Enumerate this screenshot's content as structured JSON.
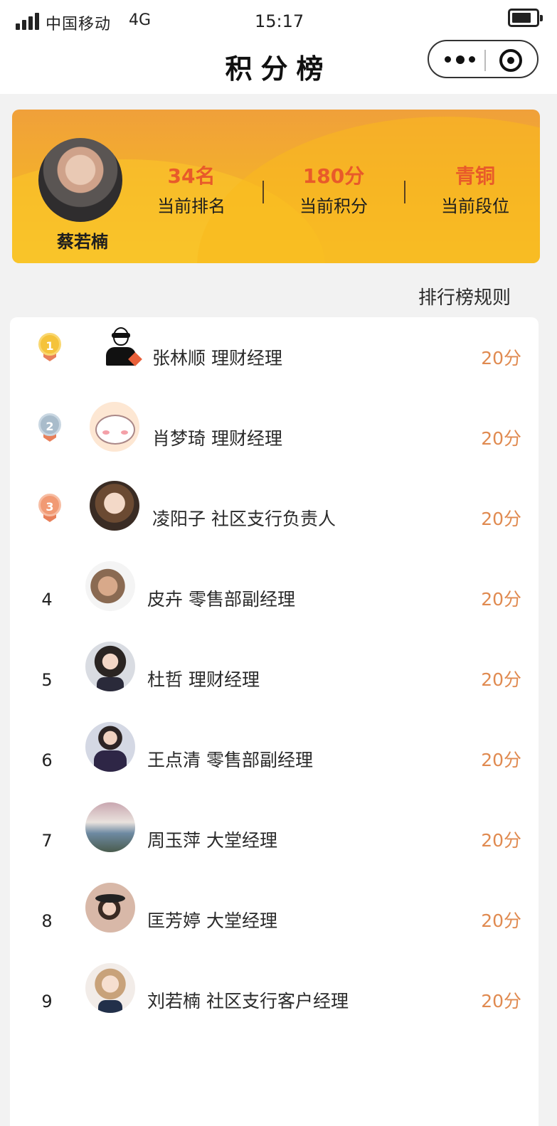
{
  "status_bar": {
    "carrier": "中国移动",
    "network": "4G",
    "time": "15:17"
  },
  "nav": {
    "title": "积分榜"
  },
  "profile": {
    "name": "蔡若楠",
    "stats": [
      {
        "value": "34名",
        "label": "当前排名"
      },
      {
        "value": "180分",
        "label": "当前积分"
      },
      {
        "value": "青铜",
        "label": "当前段位"
      }
    ]
  },
  "rules_link": "排行榜规则",
  "colors": {
    "accent": "#f4b22a",
    "stat_value": "#e85a2a",
    "score": "#e08a50",
    "gold": "#f5c33b",
    "silver": "#a9bccb",
    "bronze": "#f19a74"
  },
  "leaderboard": [
    {
      "rank": "1",
      "medal": "gold-medal-icon",
      "name": "张林顺 理财经理",
      "score": "20分"
    },
    {
      "rank": "2",
      "medal": "silver-medal-icon",
      "name": "肖梦琦 理财经理",
      "score": "20分"
    },
    {
      "rank": "3",
      "medal": "bronze-medal-icon",
      "name": "凌阳子 社区支行负责人",
      "score": "20分"
    },
    {
      "rank": "4",
      "name": "皮卉 零售部副经理",
      "score": "20分"
    },
    {
      "rank": "5",
      "name": "杜哲 理财经理",
      "score": "20分"
    },
    {
      "rank": "6",
      "name": "王点清 零售部副经理",
      "score": "20分"
    },
    {
      "rank": "7",
      "name": "周玉萍 大堂经理",
      "score": "20分"
    },
    {
      "rank": "8",
      "name": "匡芳婷 大堂经理",
      "score": "20分"
    },
    {
      "rank": "9",
      "name": "刘若楠 社区支行客户经理",
      "score": "20分"
    }
  ]
}
